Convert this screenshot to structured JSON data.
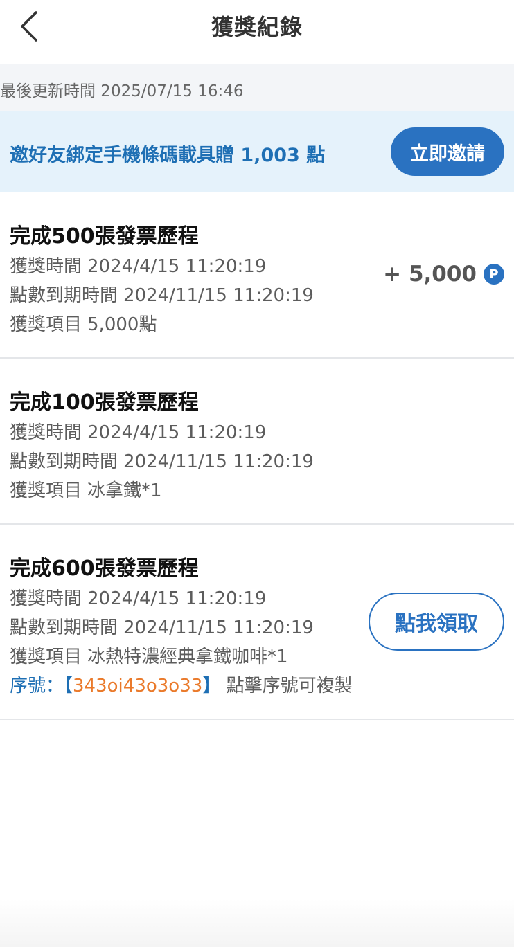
{
  "header": {
    "title": "獲獎紀錄",
    "back_icon": "chevron-left-icon"
  },
  "updated": {
    "text": "最後更新時間 2025/07/15 16:46"
  },
  "invite": {
    "text": "邀好友綁定手機條碼載具贈 1,003 點",
    "button_label": "立即邀請",
    "accent_color": "#2a72c1"
  },
  "records": [
    {
      "title": "完成500張發票歷程",
      "time_label": "獲獎時間",
      "time_value": "2024/4/15 11:20:19",
      "expire_label": "點數到期時間",
      "expire_value": "2024/11/15 11:20:19",
      "item_label": "獲獎項目",
      "item_value": "5,000點",
      "points": "+ 5,000",
      "points_icon": "P"
    },
    {
      "title": "完成100張發票歷程",
      "time_label": "獲獎時間",
      "time_value": "2024/4/15 11:20:19",
      "expire_label": "點數到期時間",
      "expire_value": "2024/11/15 11:20:19",
      "item_label": "獲獎項目",
      "item_value": "冰拿鐵*1"
    },
    {
      "title": "完成600張發票歷程",
      "time_label": "獲獎時間",
      "time_value": "2024/4/15 11:20:19",
      "expire_label": "點數到期時間",
      "expire_value": "2024/11/15 11:20:19",
      "item_label": "獲獎項目",
      "item_value": "冰熱特濃經典拿鐵咖啡*1",
      "serial_prefix": "序號：【",
      "serial_code": "343oi43o3o33",
      "serial_suffix": "】",
      "serial_hint": "點擊序號可複製",
      "claim_label": "點我領取"
    }
  ]
}
